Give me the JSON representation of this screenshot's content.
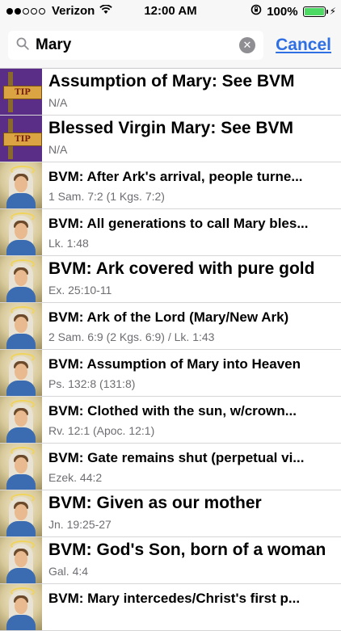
{
  "status_bar": {
    "carrier": "Verizon",
    "time": "12:00 AM",
    "battery_percent": "100%",
    "signal_bars_filled": 2,
    "signal_bars_total": 5,
    "battery_color": "#4cd964"
  },
  "search": {
    "query": "Mary",
    "cancel_label": "Cancel",
    "accent_color": "#2f6fe4"
  },
  "results": [
    {
      "title": "Assumption of Mary: See BVM",
      "subtitle": "N/A",
      "thumb": "tip",
      "thumb_label": "TIP",
      "size": "big"
    },
    {
      "title": "Blessed Virgin Mary: See BVM",
      "subtitle": "N/A",
      "thumb": "tip",
      "thumb_label": "TIP",
      "size": "big"
    },
    {
      "title": "BVM: After Ark's arrival, people turne...",
      "subtitle": "1 Sam. 7:2 (1 Kgs. 7:2)",
      "thumb": "mary",
      "size": "small"
    },
    {
      "title": "BVM: All generations to call Mary bles...",
      "subtitle": "Lk. 1:48",
      "thumb": "mary",
      "size": "small"
    },
    {
      "title": "BVM: Ark covered with pure gold",
      "subtitle": "Ex. 25:10-11",
      "thumb": "mary",
      "size": "big"
    },
    {
      "title": "BVM: Ark of the Lord (Mary/New Ark)",
      "subtitle": "2 Sam. 6:9 (2 Kgs. 6:9) / Lk. 1:43",
      "thumb": "mary",
      "size": "small"
    },
    {
      "title": "BVM: Assumption of Mary into Heaven",
      "subtitle": "Ps. 132:8 (131:8)",
      "thumb": "mary",
      "size": "small"
    },
    {
      "title": "BVM: Clothed with the sun, w/crown...",
      "subtitle": "Rv. 12:1 (Apoc. 12:1)",
      "thumb": "mary",
      "size": "small"
    },
    {
      "title": "BVM: Gate remains shut (perpetual vi...",
      "subtitle": "Ezek. 44:2",
      "thumb": "mary",
      "size": "small"
    },
    {
      "title": "BVM: Given as our mother",
      "subtitle": "Jn. 19:25-27",
      "thumb": "mary",
      "size": "big"
    },
    {
      "title": "BVM: God's Son, born of a woman",
      "subtitle": "Gal. 4:4",
      "thumb": "mary",
      "size": "big"
    },
    {
      "title": "BVM: Mary intercedes/Christ's first p...",
      "subtitle": "",
      "thumb": "mary",
      "size": "small"
    }
  ]
}
